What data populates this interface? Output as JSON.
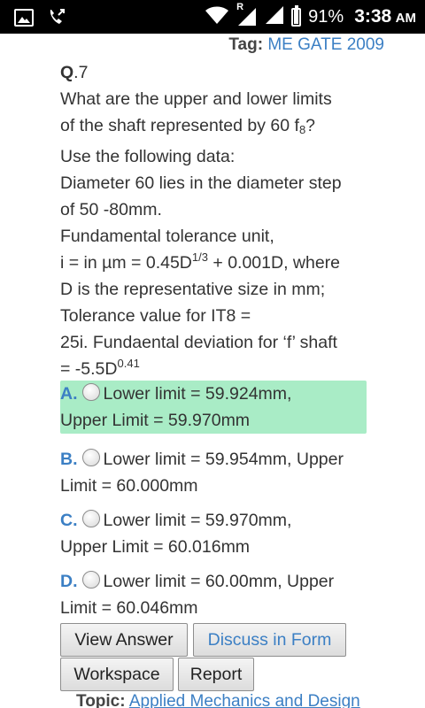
{
  "status_bar": {
    "battery_percent": "91%",
    "time": "3:38",
    "ampm": "AM",
    "roaming": "R"
  },
  "tag": {
    "label": "Tag:",
    "value": "ME GATE 2009"
  },
  "question": {
    "number_prefix": "Q",
    "number": ".7",
    "line1": "What are the upper and lower limits",
    "line2a": "of the shaft represented by 60 f",
    "line2sub": "8",
    "line2b": "?",
    "line3": "Use the following data:",
    "line4": "Diameter 60 lies in the diameter step",
    "line5": "of 50 -80mm.",
    "line6": "Fundamental tolerance unit,",
    "line7a": "i = in µm = 0.45D",
    "line7sup": "1/3",
    "line7b": " + 0.001D, where",
    "line8": "D is the representative size in mm;",
    "line9": "Tolerance value for IT8 =",
    "line10": "25i. Fundaental deviation for ‘f’ shaft",
    "line11a": "= -5.5D",
    "line11sup": "0.41"
  },
  "options": [
    {
      "letter": "A.",
      "line1": "Lower limit = 59.924mm,",
      "line2": "Upper Limit = 59.970mm",
      "correct": true
    },
    {
      "letter": "B.",
      "line1": "Lower limit = 59.954mm, Upper",
      "line2": "Limit = 60.000mm",
      "correct": false
    },
    {
      "letter": "C.",
      "line1": "Lower limit = 59.970mm,",
      "line2": "Upper Limit = 60.016mm",
      "correct": false
    },
    {
      "letter": "D.",
      "line1": "Lower limit = 60.00mm, Upper",
      "line2": "Limit = 60.046mm",
      "correct": false
    }
  ],
  "buttons": {
    "view_answer": "View Answer",
    "discuss": "Discuss in Form",
    "workspace": "Workspace",
    "report": "Report"
  },
  "topic": {
    "label": "Topic:",
    "value": "Applied Mechanics and Design"
  },
  "colors": {
    "link": "#3b7fc4",
    "correct_bg": "#a9ecc6",
    "status_bar": "#000000"
  },
  "icons": [
    "image-icon",
    "missed-call-icon",
    "wifi-icon",
    "signal-icon",
    "battery-icon"
  ]
}
